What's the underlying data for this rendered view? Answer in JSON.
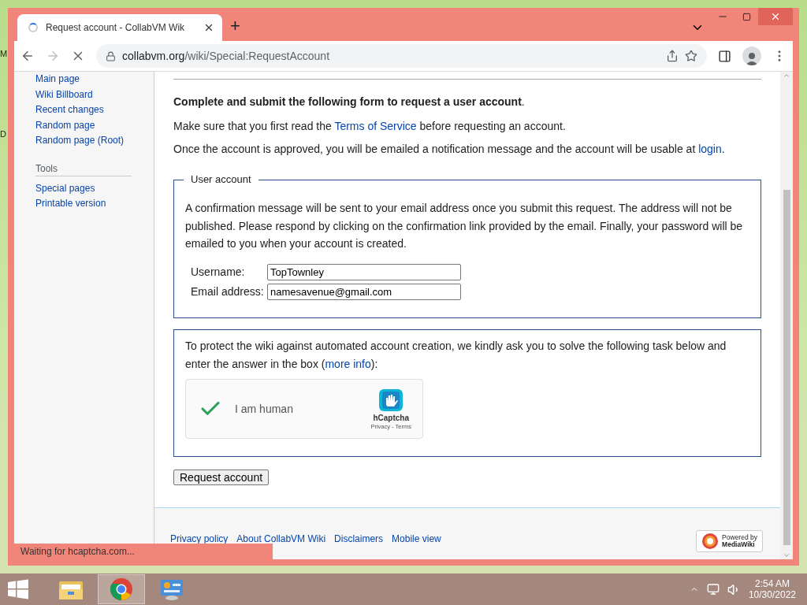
{
  "desktop": {
    "icon_labels": [
      "M",
      "D"
    ]
  },
  "browser": {
    "tab": {
      "title": "Request account - CollabVM Wik",
      "loading": true
    },
    "new_tab": "+",
    "url_host": "collabvm.org",
    "url_path": "/wiki/Special:RequestAccount",
    "forward_disabled": true,
    "status": "Waiting for hcaptcha.com..."
  },
  "sidebar": {
    "nav": [
      "Main page",
      "Wiki Billboard",
      "Recent changes",
      "Random page",
      "Random page (Root)"
    ],
    "tools_heading": "Tools",
    "tools": [
      "Special pages",
      "Printable version"
    ]
  },
  "intro": [
    [
      {
        "text": "**Complete and submit the following form to request a user account**."
      }
    ],
    [
      {
        "text": "Make sure that you first read the "
      },
      {
        "text": "Terms of Service",
        "link": true
      },
      {
        "text": " before requesting an account."
      }
    ],
    [
      {
        "text": "Once the account is approved, you will be emailed a notification message and the account will be usable at "
      },
      {
        "text": "login",
        "link": true
      },
      {
        "text": "."
      }
    ]
  ],
  "user_account": {
    "legend": "User account",
    "note": "A confirmation message will be sent to your email address once you submit this request. The address will not be published. Please respond by clicking on the confirmation link provided by the email. Finally, your password will be emailed to you when your account is created.",
    "fields": [
      {
        "label": "Username:",
        "value": "TopTownley"
      },
      {
        "label": "Email address:",
        "value": "namesavenue@gmail.com"
      }
    ]
  },
  "captcha": {
    "text": [
      {
        "text": "To protect the wiki against automated account creation, we kindly ask you to solve the following task below and enter the answer in the box ("
      },
      {
        "text": "more info",
        "link": true
      },
      {
        "text": "):"
      }
    ],
    "checked": true,
    "label": "I am human",
    "brand": "hCaptcha",
    "links": "Privacy - Terms"
  },
  "submit": "Request account",
  "footer": {
    "links": [
      "Privacy policy",
      "About CollabVM Wiki",
      "Disclaimers",
      "Mobile view"
    ],
    "badge_top": "Powered by",
    "badge_bottom": "MediaWiki"
  },
  "taskbar": {
    "apps": [
      {
        "kind": "explorer",
        "selected": false
      },
      {
        "kind": "chrome",
        "selected": true
      },
      {
        "kind": "control",
        "selected": false
      }
    ],
    "time": "2:54 AM",
    "date": "10/30/2022"
  }
}
